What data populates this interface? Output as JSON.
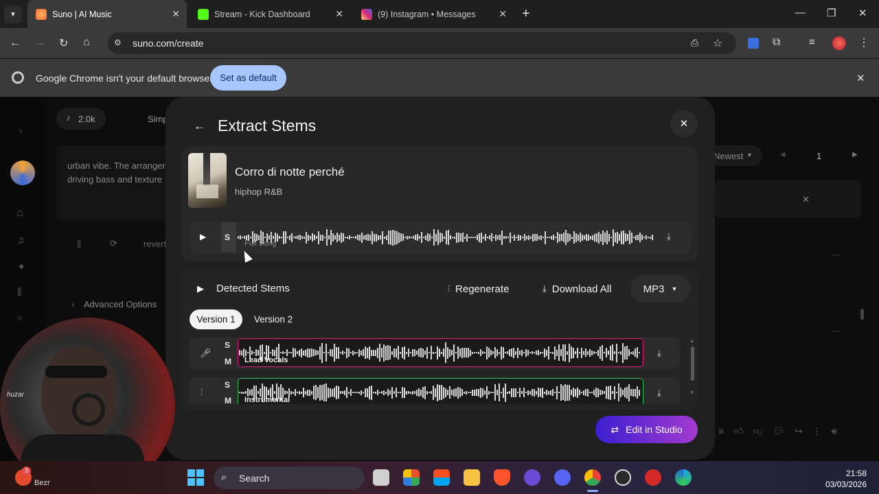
{
  "browser": {
    "tabs": [
      {
        "title": "Suno | AI Music",
        "active": true,
        "favicon_color": "#f06a2a"
      },
      {
        "title": "Stream - Kick Dashboard",
        "active": false,
        "favicon_color": "#53fc18"
      },
      {
        "title": "(9) Instagram • Messages",
        "active": false,
        "favicon_color": "#d6249f"
      }
    ],
    "url": "suno.com/create",
    "infobar": {
      "message": "Google Chrome isn't your default browser",
      "button": "Set as default"
    }
  },
  "background_page": {
    "count": "2.0k",
    "sort_partial": "Simp",
    "description": "urban vibe. The arranger\ndriving bass and texture",
    "revert": "revert",
    "advanced_options": "Advanced Options",
    "sort": "Newest",
    "page": "1"
  },
  "modal": {
    "title": "Extract Stems",
    "song": {
      "title": "Corro di notte perché",
      "genre": "hiphop R&B",
      "full_label": "Full Song",
      "solo_letter": "S"
    },
    "stems": {
      "heading": "Detected Stems",
      "regenerate": "Regenerate",
      "download_all": "Download All",
      "format": "MP3",
      "versions": [
        "Version 1",
        "Version 2"
      ],
      "selected_version": "Version 1",
      "rows": [
        {
          "name": "Lead Vocals",
          "solo": "S",
          "mute": "M",
          "color": "#e0197d"
        },
        {
          "name": "Instrumental",
          "solo": "S",
          "mute": "M",
          "color": "#2fbf5a"
        }
      ]
    },
    "edit_studio": "Edit in Studio"
  },
  "webcam": {
    "overlay": "huzar",
    "badge": "3",
    "weather_partial": "Bezr"
  },
  "taskbar": {
    "search": "Search",
    "time": "21:58",
    "date": "03/03/2026"
  }
}
